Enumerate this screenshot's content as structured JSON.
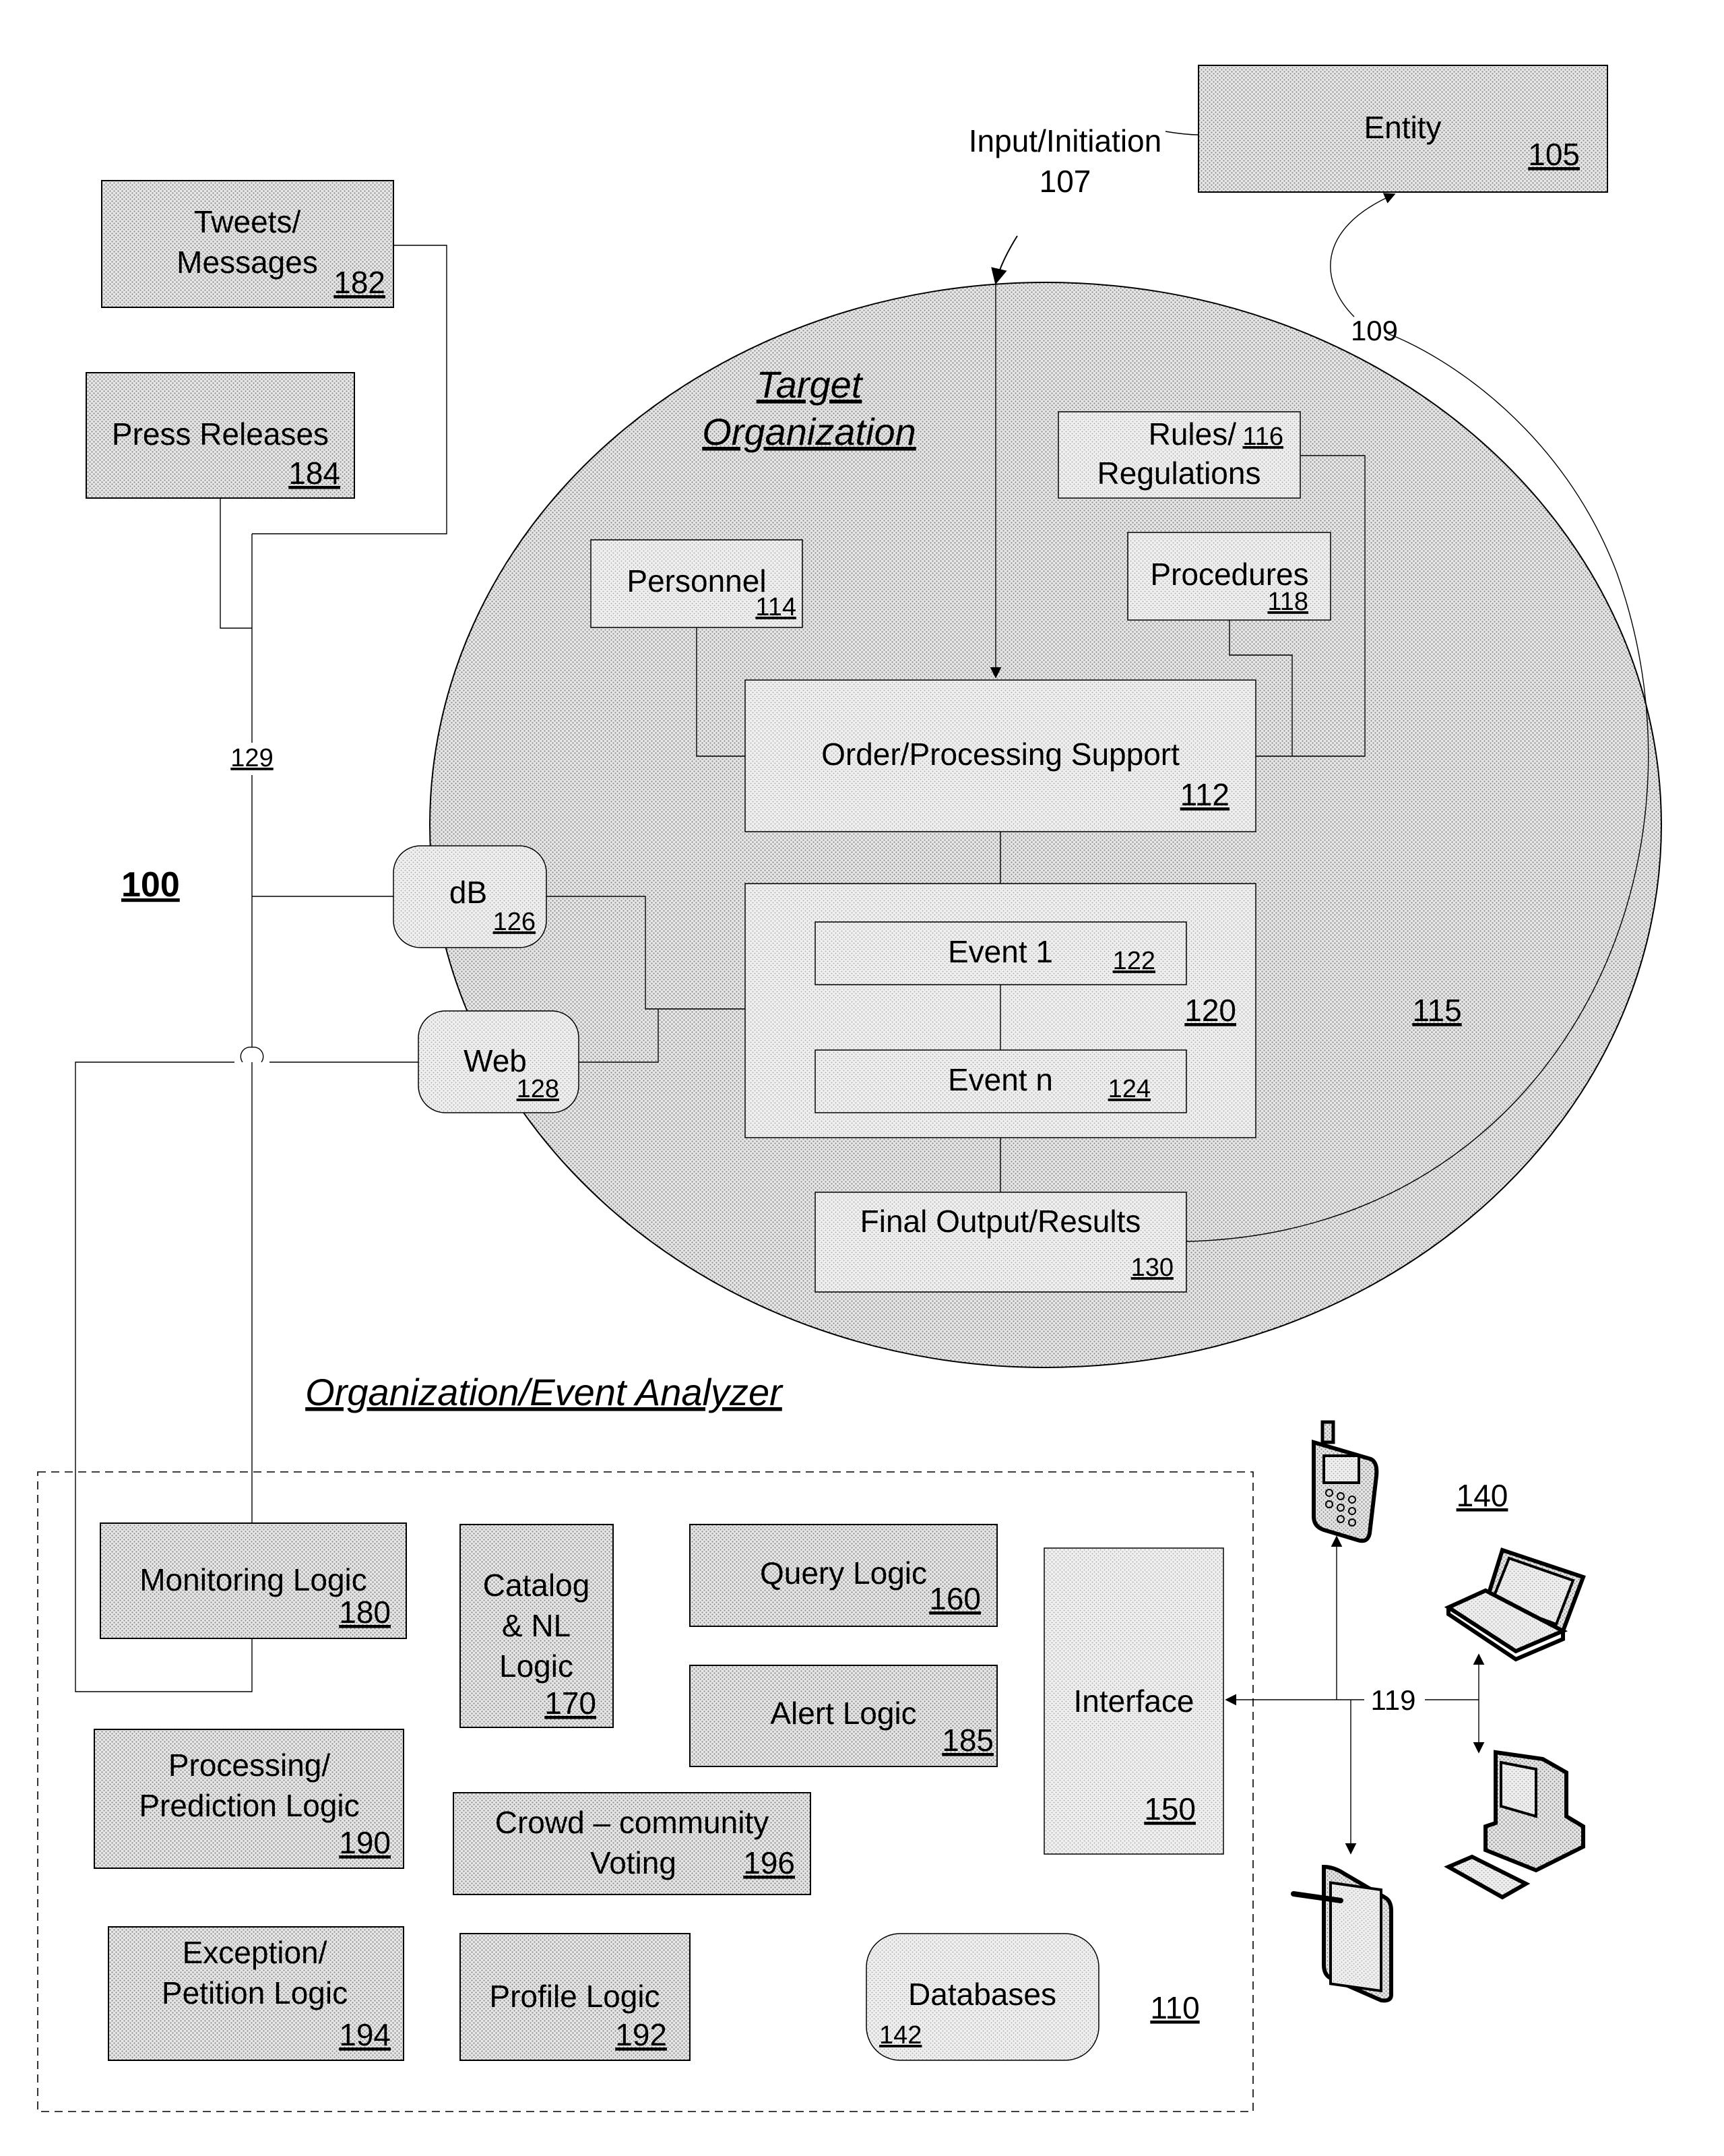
{
  "figure": {
    "number": "100"
  },
  "entity": {
    "label": "Entity",
    "ref": "105"
  },
  "input": {
    "label": "Input/Initiation",
    "ref": "107"
  },
  "feedback": {
    "ref": "109"
  },
  "sources": {
    "tweets": {
      "line1": "Tweets/",
      "line2": "Messages",
      "ref": "182"
    },
    "press": {
      "label": "Press Releases",
      "ref": "184"
    },
    "bus_ref": "129"
  },
  "target_org": {
    "title_line1": "Target",
    "title_line2": "Organization",
    "ref": "115",
    "rules": {
      "line1": "Rules/",
      "line2": "Regulations",
      "ref": "116"
    },
    "procedures": {
      "label": "Procedures",
      "ref": "118"
    },
    "personnel": {
      "label": "Personnel",
      "ref": "114"
    },
    "order": {
      "label": "Order/Processing Support",
      "ref": "112"
    },
    "events": {
      "ref": "120",
      "items": [
        {
          "label": "Event 1",
          "ref": "122"
        },
        {
          "label": "Event n",
          "ref": "124"
        }
      ]
    },
    "final": {
      "label": "Final Output/Results",
      "ref": "130"
    },
    "db": {
      "label": "dB",
      "ref": "126"
    },
    "web": {
      "label": "Web",
      "ref": "128"
    }
  },
  "analyzer": {
    "title": "Organization/Event Analyzer",
    "ref": "110",
    "modules": {
      "monitoring": {
        "label": "Monitoring Logic",
        "ref": "180"
      },
      "catalog": {
        "line1": "Catalog",
        "line2": "& NL",
        "line3": "Logic",
        "ref": "170"
      },
      "query": {
        "label": "Query Logic",
        "ref": "160"
      },
      "alert": {
        "label": "Alert Logic",
        "ref": "185"
      },
      "interface": {
        "label": "Interface",
        "ref": "150"
      },
      "processing": {
        "line1": "Processing/",
        "line2": "Prediction Logic",
        "ref": "190"
      },
      "crowd": {
        "line1": "Crowd – community",
        "line2": "Voting",
        "ref": "196"
      },
      "exception": {
        "line1": "Exception/",
        "line2": "Petition Logic",
        "ref": "194"
      },
      "profile": {
        "label": "Profile Logic",
        "ref": "192"
      },
      "databases": {
        "label": "Databases",
        "ref": "142"
      }
    }
  },
  "devices": {
    "ref": "140",
    "link_ref": "119",
    "items": [
      "mobile-phone",
      "laptop",
      "desktop-computer",
      "tablet"
    ]
  }
}
